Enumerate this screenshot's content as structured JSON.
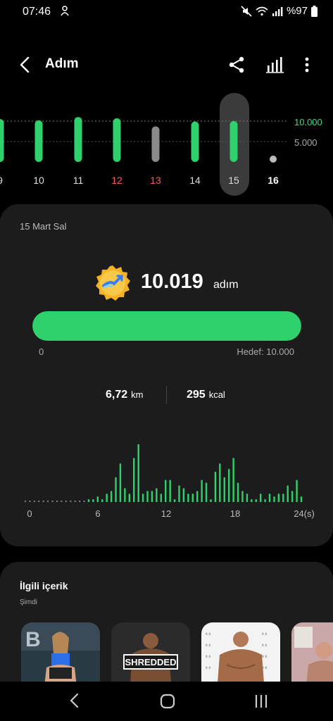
{
  "status_bar": {
    "time": "07:46",
    "battery": "%97"
  },
  "app_bar": {
    "title": "Adım"
  },
  "week_chart": {
    "y_ticks": [
      "10.000",
      "5.000"
    ],
    "goal": 10000,
    "days": [
      {
        "label": "9",
        "value": 10500,
        "color": "green"
      },
      {
        "label": "10",
        "value": 10200,
        "color": "green"
      },
      {
        "label": "11",
        "value": 11000,
        "color": "green"
      },
      {
        "label": "12",
        "value": 10700,
        "color": "green",
        "weekend": true
      },
      {
        "label": "13",
        "value": 8700,
        "color": "grey",
        "weekend": true
      },
      {
        "label": "14",
        "value": 9900,
        "color": "green"
      },
      {
        "label": "15",
        "value": 10019,
        "color": "green",
        "selected": true
      },
      {
        "label": "16",
        "value": 0,
        "color": "grey",
        "today": true
      }
    ]
  },
  "summary": {
    "date": "15 Mart Sal",
    "steps": "10.019",
    "steps_unit": "adım",
    "progress_fraction": 1.0,
    "progress_min_label": "0",
    "progress_goal_label": "Hedef: 10.000",
    "distance_value": "6,72",
    "distance_unit": "km",
    "calories_value": "295",
    "calories_unit": "kcal"
  },
  "hourly_chart": {
    "x_labels": [
      "0",
      "6",
      "12",
      "18",
      "24(s)"
    ],
    "values": [
      0,
      0,
      0,
      0,
      0,
      0,
      0,
      0,
      0,
      0,
      0,
      0,
      0,
      0,
      1,
      1,
      2,
      1,
      3,
      4,
      9,
      14,
      5,
      3,
      16,
      21,
      3,
      4,
      4,
      5,
      3,
      8,
      8,
      1,
      6,
      5,
      3,
      3,
      4,
      8,
      7,
      1,
      11,
      14,
      9,
      12,
      16,
      7,
      4,
      3,
      1,
      1,
      3,
      1,
      3,
      2,
      3,
      3,
      6,
      4,
      8,
      2
    ]
  },
  "related": {
    "heading": "İlgili içerik",
    "subheading": "Şimdi",
    "cards": [
      {
        "name": "fitness-woman-card",
        "overlay_text": ""
      },
      {
        "name": "shredded-card",
        "overlay_text": "SHREDDED"
      },
      {
        "name": "bodybuilder-card",
        "overlay_text": ""
      },
      {
        "name": "body-card",
        "overlay_text": ""
      }
    ]
  },
  "colors": {
    "accent": "#2ed16b",
    "inactive_bar": "#8a8a8a",
    "weekend_label": "#ff5a5a",
    "card_bg": "#1c1c1c"
  }
}
